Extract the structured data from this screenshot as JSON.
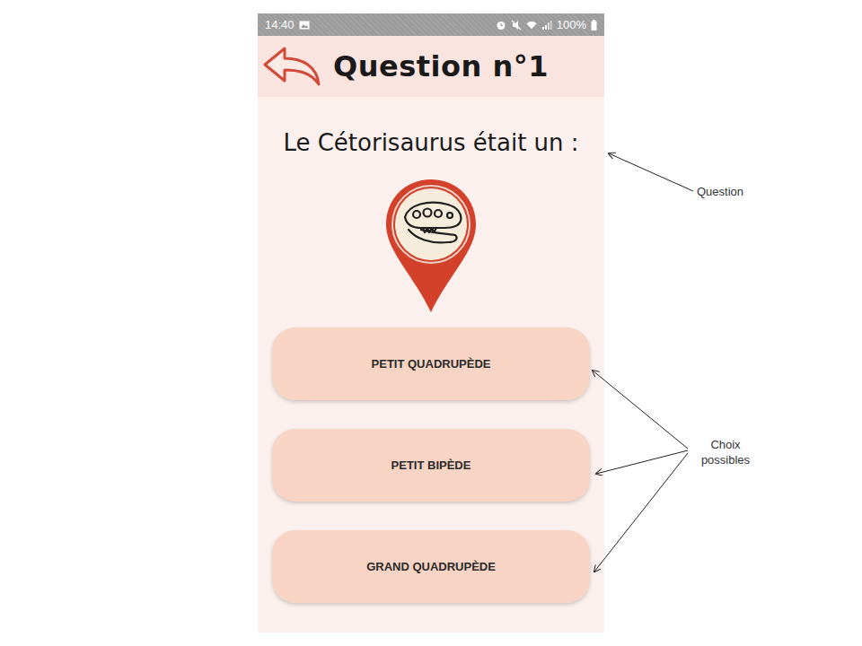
{
  "status_bar": {
    "time": "14:40",
    "battery": "100%"
  },
  "header": {
    "title": "Question n°1"
  },
  "question": {
    "text": "Le Cétorisaurus était un :"
  },
  "choices": [
    {
      "label": "PETIT QUADRUPÈDE"
    },
    {
      "label": "PETIT BIPÈDE"
    },
    {
      "label": "GRAND QUADRUPÈDE"
    }
  ],
  "annotations": [
    {
      "label": "Question"
    },
    {
      "label": "Choix possibles"
    }
  ]
}
